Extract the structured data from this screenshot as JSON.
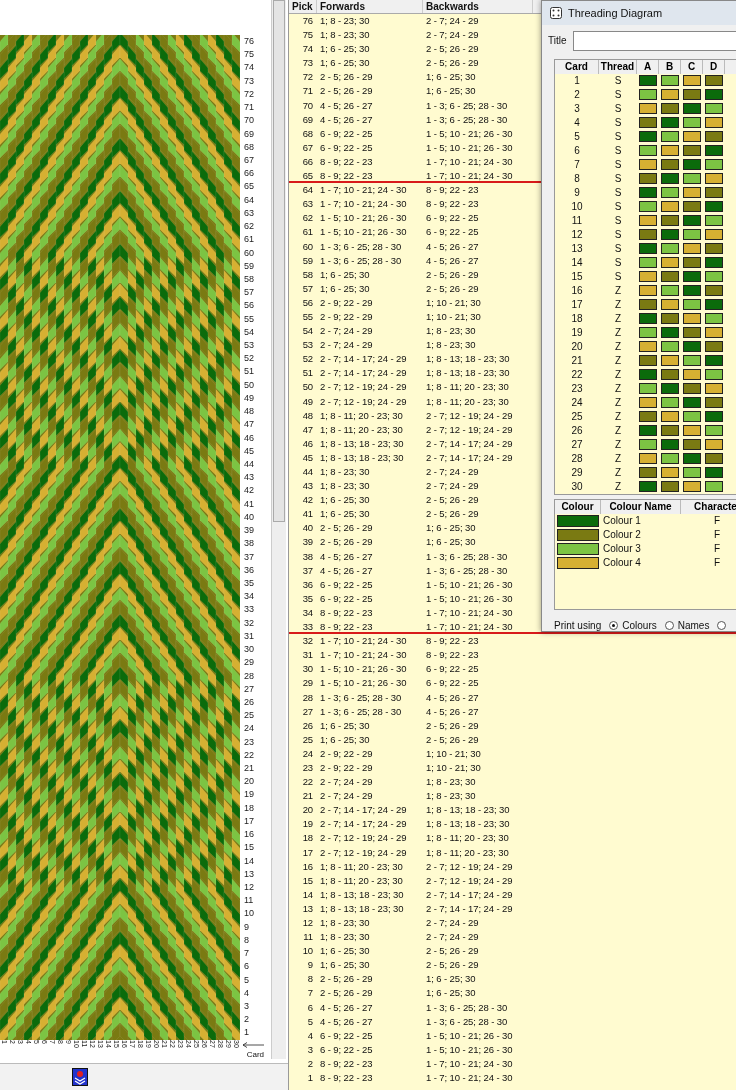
{
  "band": {
    "pick_labels": [
      "76",
      "75",
      "74",
      "73",
      "72",
      "71",
      "70",
      "69",
      "68",
      "67",
      "66",
      "65",
      "64",
      "63",
      "62",
      "61",
      "60",
      "59",
      "58",
      "57",
      "56",
      "55",
      "54",
      "53",
      "52",
      "51",
      "50",
      "49",
      "48",
      "47",
      "46",
      "45",
      "44",
      "43",
      "42",
      "41",
      "40",
      "39",
      "38",
      "37",
      "36",
      "35",
      "34",
      "33",
      "32",
      "31",
      "30",
      "29",
      "28",
      "27",
      "26",
      "25",
      "24",
      "23",
      "22",
      "21",
      "20",
      "19",
      "18",
      "17",
      "16",
      "15",
      "14",
      "13",
      "12",
      "11",
      "10",
      "9",
      "8",
      "7",
      "6",
      "5",
      "4",
      "3",
      "2",
      "1"
    ],
    "card_labels": [
      "1",
      "2",
      "3",
      "4",
      "5",
      "6",
      "7",
      "8",
      "9",
      "10",
      "11",
      "12",
      "13",
      "14",
      "15",
      "16",
      "17",
      "18",
      "19",
      "20",
      "21",
      "22",
      "23",
      "24",
      "25",
      "26",
      "27",
      "28",
      "29",
      "30"
    ],
    "axis_label": "Card"
  },
  "turning_table": {
    "columns": [
      "Pick",
      "Forwards",
      "Backwards"
    ],
    "rows": [
      {
        "pick": "76",
        "forwards": "1; 8 - 23; 30",
        "backwards": "2 - 7; 24 - 29",
        "marked": false
      },
      {
        "pick": "75",
        "forwards": "1; 8 - 23; 30",
        "backwards": "2 - 7; 24 - 29",
        "marked": false
      },
      {
        "pick": "74",
        "forwards": "1; 6 - 25; 30",
        "backwards": "2 - 5; 26 - 29",
        "marked": false
      },
      {
        "pick": "73",
        "forwards": "1; 6 - 25; 30",
        "backwards": "2 - 5; 26 - 29",
        "marked": false
      },
      {
        "pick": "72",
        "forwards": "2 - 5; 26 - 29",
        "backwards": "1; 6 - 25; 30",
        "marked": false
      },
      {
        "pick": "71",
        "forwards": "2 - 5; 26 - 29",
        "backwards": "1; 6 - 25; 30",
        "marked": false
      },
      {
        "pick": "70",
        "forwards": "4 - 5; 26 - 27",
        "backwards": "1 - 3; 6 - 25; 28 - 30",
        "marked": false
      },
      {
        "pick": "69",
        "forwards": "4 - 5; 26 - 27",
        "backwards": "1 - 3; 6 - 25; 28 - 30",
        "marked": false
      },
      {
        "pick": "68",
        "forwards": "6 - 9; 22 - 25",
        "backwards": "1 - 5; 10 - 21; 26 - 30",
        "marked": false
      },
      {
        "pick": "67",
        "forwards": "6 - 9; 22 - 25",
        "backwards": "1 - 5; 10 - 21; 26 - 30",
        "marked": false
      },
      {
        "pick": "66",
        "forwards": "8 - 9; 22 - 23",
        "backwards": "1 - 7; 10 - 21; 24 - 30",
        "marked": false
      },
      {
        "pick": "65",
        "forwards": "8 - 9; 22 - 23",
        "backwards": "1 - 7; 10 - 21; 24 - 30",
        "marked": true
      },
      {
        "pick": "64",
        "forwards": "1 - 7; 10 - 21; 24 - 30",
        "backwards": "8 - 9; 22 - 23",
        "marked": false
      },
      {
        "pick": "63",
        "forwards": "1 - 7; 10 - 21; 24 - 30",
        "backwards": "8 - 9; 22 - 23",
        "marked": false
      },
      {
        "pick": "62",
        "forwards": "1 - 5; 10 - 21; 26 - 30",
        "backwards": "6 - 9; 22 - 25",
        "marked": false
      },
      {
        "pick": "61",
        "forwards": "1 - 5; 10 - 21; 26 - 30",
        "backwards": "6 - 9; 22 - 25",
        "marked": false
      },
      {
        "pick": "60",
        "forwards": "1 - 3; 6 - 25; 28 - 30",
        "backwards": "4 - 5; 26 - 27",
        "marked": false
      },
      {
        "pick": "59",
        "forwards": "1 - 3; 6 - 25; 28 - 30",
        "backwards": "4 - 5; 26 - 27",
        "marked": false
      },
      {
        "pick": "58",
        "forwards": "1; 6 - 25; 30",
        "backwards": "2 - 5; 26 - 29",
        "marked": false
      },
      {
        "pick": "57",
        "forwards": "1; 6 - 25; 30",
        "backwards": "2 - 5; 26 - 29",
        "marked": false
      },
      {
        "pick": "56",
        "forwards": "2 - 9; 22 - 29",
        "backwards": "1; 10 - 21; 30",
        "marked": false
      },
      {
        "pick": "55",
        "forwards": "2 - 9; 22 - 29",
        "backwards": "1; 10 - 21; 30",
        "marked": false
      },
      {
        "pick": "54",
        "forwards": "2 - 7; 24 - 29",
        "backwards": "1; 8 - 23; 30",
        "marked": false
      },
      {
        "pick": "53",
        "forwards": "2 - 7; 24 - 29",
        "backwards": "1; 8 - 23; 30",
        "marked": false
      },
      {
        "pick": "52",
        "forwards": "2 - 7; 14 - 17; 24 - 29",
        "backwards": "1; 8 - 13; 18 - 23; 30",
        "marked": false
      },
      {
        "pick": "51",
        "forwards": "2 - 7; 14 - 17; 24 - 29",
        "backwards": "1; 8 - 13; 18 - 23; 30",
        "marked": false
      },
      {
        "pick": "50",
        "forwards": "2 - 7; 12 - 19; 24 - 29",
        "backwards": "1; 8 - 11; 20 - 23; 30",
        "marked": false
      },
      {
        "pick": "49",
        "forwards": "2 - 7; 12 - 19; 24 - 29",
        "backwards": "1; 8 - 11; 20 - 23; 30",
        "marked": false
      },
      {
        "pick": "48",
        "forwards": "1; 8 - 11; 20 - 23; 30",
        "backwards": "2 - 7; 12 - 19; 24 - 29",
        "marked": false
      },
      {
        "pick": "47",
        "forwards": "1; 8 - 11; 20 - 23; 30",
        "backwards": "2 - 7; 12 - 19; 24 - 29",
        "marked": false
      },
      {
        "pick": "46",
        "forwards": "1; 8 - 13; 18 - 23; 30",
        "backwards": "2 - 7; 14 - 17; 24 - 29",
        "marked": false
      },
      {
        "pick": "45",
        "forwards": "1; 8 - 13; 18 - 23; 30",
        "backwards": "2 - 7; 14 - 17; 24 - 29",
        "marked": false
      },
      {
        "pick": "44",
        "forwards": "1; 8 - 23; 30",
        "backwards": "2 - 7; 24 - 29",
        "marked": false
      },
      {
        "pick": "43",
        "forwards": "1; 8 - 23; 30",
        "backwards": "2 - 7; 24 - 29",
        "marked": false
      },
      {
        "pick": "42",
        "forwards": "1; 6 - 25; 30",
        "backwards": "2 - 5; 26 - 29",
        "marked": false
      },
      {
        "pick": "41",
        "forwards": "1; 6 - 25; 30",
        "backwards": "2 - 5; 26 - 29",
        "marked": false
      },
      {
        "pick": "40",
        "forwards": "2 - 5; 26 - 29",
        "backwards": "1; 6 - 25; 30",
        "marked": false
      },
      {
        "pick": "39",
        "forwards": "2 - 5; 26 - 29",
        "backwards": "1; 6 - 25; 30",
        "marked": false
      },
      {
        "pick": "38",
        "forwards": "4 - 5; 26 - 27",
        "backwards": "1 - 3; 6 - 25; 28 - 30",
        "marked": false
      },
      {
        "pick": "37",
        "forwards": "4 - 5; 26 - 27",
        "backwards": "1 - 3; 6 - 25; 28 - 30",
        "marked": false
      },
      {
        "pick": "36",
        "forwards": "6 - 9; 22 - 25",
        "backwards": "1 - 5; 10 - 21; 26 - 30",
        "marked": false
      },
      {
        "pick": "35",
        "forwards": "6 - 9; 22 - 25",
        "backwards": "1 - 5; 10 - 21; 26 - 30",
        "marked": false
      },
      {
        "pick": "34",
        "forwards": "8 - 9; 22 - 23",
        "backwards": "1 - 7; 10 - 21; 24 - 30",
        "marked": false
      },
      {
        "pick": "33",
        "forwards": "8 - 9; 22 - 23",
        "backwards": "1 - 7; 10 - 21; 24 - 30",
        "marked": true
      },
      {
        "pick": "32",
        "forwards": "1 - 7; 10 - 21; 24 - 30",
        "backwards": "8 - 9; 22 - 23",
        "marked": false
      },
      {
        "pick": "31",
        "forwards": "1 - 7; 10 - 21; 24 - 30",
        "backwards": "8 - 9; 22 - 23",
        "marked": false
      },
      {
        "pick": "30",
        "forwards": "1 - 5; 10 - 21; 26 - 30",
        "backwards": "6 - 9; 22 - 25",
        "marked": false
      },
      {
        "pick": "29",
        "forwards": "1 - 5; 10 - 21; 26 - 30",
        "backwards": "6 - 9; 22 - 25",
        "marked": false
      },
      {
        "pick": "28",
        "forwards": "1 - 3; 6 - 25; 28 - 30",
        "backwards": "4 - 5; 26 - 27",
        "marked": false
      },
      {
        "pick": "27",
        "forwards": "1 - 3; 6 - 25; 28 - 30",
        "backwards": "4 - 5; 26 - 27",
        "marked": false
      },
      {
        "pick": "26",
        "forwards": "1; 6 - 25; 30",
        "backwards": "2 - 5; 26 - 29",
        "marked": false
      },
      {
        "pick": "25",
        "forwards": "1; 6 - 25; 30",
        "backwards": "2 - 5; 26 - 29",
        "marked": false
      },
      {
        "pick": "24",
        "forwards": "2 - 9; 22 - 29",
        "backwards": "1; 10 - 21; 30",
        "marked": false
      },
      {
        "pick": "23",
        "forwards": "2 - 9; 22 - 29",
        "backwards": "1; 10 - 21; 30",
        "marked": false
      },
      {
        "pick": "22",
        "forwards": "2 - 7; 24 - 29",
        "backwards": "1; 8 - 23; 30",
        "marked": false
      },
      {
        "pick": "21",
        "forwards": "2 - 7; 24 - 29",
        "backwards": "1; 8 - 23; 30",
        "marked": false
      },
      {
        "pick": "20",
        "forwards": "2 - 7; 14 - 17; 24 - 29",
        "backwards": "1; 8 - 13; 18 - 23; 30",
        "marked": false
      },
      {
        "pick": "19",
        "forwards": "2 - 7; 14 - 17; 24 - 29",
        "backwards": "1; 8 - 13; 18 - 23; 30",
        "marked": false
      },
      {
        "pick": "18",
        "forwards": "2 - 7; 12 - 19; 24 - 29",
        "backwards": "1; 8 - 11; 20 - 23; 30",
        "marked": false
      },
      {
        "pick": "17",
        "forwards": "2 - 7; 12 - 19; 24 - 29",
        "backwards": "1; 8 - 11; 20 - 23; 30",
        "marked": false
      },
      {
        "pick": "16",
        "forwards": "1; 8 - 11; 20 - 23; 30",
        "backwards": "2 - 7; 12 - 19; 24 - 29",
        "marked": false
      },
      {
        "pick": "15",
        "forwards": "1; 8 - 11; 20 - 23; 30",
        "backwards": "2 - 7; 12 - 19; 24 - 29",
        "marked": false
      },
      {
        "pick": "14",
        "forwards": "1; 8 - 13; 18 - 23; 30",
        "backwards": "2 - 7; 14 - 17; 24 - 29",
        "marked": false
      },
      {
        "pick": "13",
        "forwards": "1; 8 - 13; 18 - 23; 30",
        "backwards": "2 - 7; 14 - 17; 24 - 29",
        "marked": false
      },
      {
        "pick": "12",
        "forwards": "1; 8 - 23; 30",
        "backwards": "2 - 7; 24 - 29",
        "marked": false
      },
      {
        "pick": "11",
        "forwards": "1; 8 - 23; 30",
        "backwards": "2 - 7; 24 - 29",
        "marked": false
      },
      {
        "pick": "10",
        "forwards": "1; 6 - 25; 30",
        "backwards": "2 - 5; 26 - 29",
        "marked": false
      },
      {
        "pick": "9",
        "forwards": "1; 6 - 25; 30",
        "backwards": "2 - 5; 26 - 29",
        "marked": false
      },
      {
        "pick": "8",
        "forwards": "2 - 5; 26 - 29",
        "backwards": "1; 6 - 25; 30",
        "marked": false
      },
      {
        "pick": "7",
        "forwards": "2 - 5; 26 - 29",
        "backwards": "1; 6 - 25; 30",
        "marked": false
      },
      {
        "pick": "6",
        "forwards": "4 - 5; 26 - 27",
        "backwards": "1 - 3; 6 - 25; 28 - 30",
        "marked": false
      },
      {
        "pick": "5",
        "forwards": "4 - 5; 26 - 27",
        "backwards": "1 - 3; 6 - 25; 28 - 30",
        "marked": false
      },
      {
        "pick": "4",
        "forwards": "6 - 9; 22 - 25",
        "backwards": "1 - 5; 10 - 21; 26 - 30",
        "marked": false
      },
      {
        "pick": "3",
        "forwards": "6 - 9; 22 - 25",
        "backwards": "1 - 5; 10 - 21; 26 - 30",
        "marked": false
      },
      {
        "pick": "2",
        "forwards": "8 - 9; 22 - 23",
        "backwards": "1 - 7; 10 - 21; 24 - 30",
        "marked": false
      },
      {
        "pick": "1",
        "forwards": "8 - 9; 22 - 23",
        "backwards": "1 - 7; 10 - 21; 24 - 30",
        "marked": false
      }
    ]
  },
  "threading_dialog": {
    "title": "Threading Diagram",
    "title_field_label": "Title",
    "card_columns": [
      "Card",
      "Thread",
      "A",
      "B",
      "C",
      "D"
    ],
    "cards": [
      {
        "card": "1",
        "thread": "S",
        "holes": [
          {
            "color": "#0b6b0b"
          },
          {
            "color": "#7cc443"
          },
          {
            "color": "#d6b032"
          },
          {
            "color": "#7a7a12"
          }
        ]
      },
      {
        "card": "2",
        "thread": "S",
        "holes": [
          {
            "color": "#7cc443"
          },
          {
            "color": "#d6b032"
          },
          {
            "color": "#7a7a12"
          },
          {
            "color": "#0b6b0b"
          }
        ]
      },
      {
        "card": "3",
        "thread": "S",
        "holes": [
          {
            "color": "#d6b032"
          },
          {
            "color": "#7a7a12"
          },
          {
            "color": "#0b6b0b"
          },
          {
            "color": "#7cc443"
          }
        ]
      },
      {
        "card": "4",
        "thread": "S",
        "holes": [
          {
            "color": "#7a7a12"
          },
          {
            "color": "#0b6b0b"
          },
          {
            "color": "#7cc443"
          },
          {
            "color": "#d6b032"
          }
        ]
      },
      {
        "card": "5",
        "thread": "S",
        "holes": [
          {
            "color": "#0b6b0b"
          },
          {
            "color": "#7cc443"
          },
          {
            "color": "#d6b032"
          },
          {
            "color": "#7a7a12"
          }
        ]
      },
      {
        "card": "6",
        "thread": "S",
        "holes": [
          {
            "color": "#7cc443"
          },
          {
            "color": "#d6b032"
          },
          {
            "color": "#7a7a12"
          },
          {
            "color": "#0b6b0b"
          }
        ]
      },
      {
        "card": "7",
        "thread": "S",
        "holes": [
          {
            "color": "#d6b032"
          },
          {
            "color": "#7a7a12"
          },
          {
            "color": "#0b6b0b"
          },
          {
            "color": "#7cc443"
          }
        ]
      },
      {
        "card": "8",
        "thread": "S",
        "holes": [
          {
            "color": "#7a7a12"
          },
          {
            "color": "#0b6b0b"
          },
          {
            "color": "#7cc443"
          },
          {
            "color": "#d6b032"
          }
        ]
      },
      {
        "card": "9",
        "thread": "S",
        "holes": [
          {
            "color": "#0b6b0b"
          },
          {
            "color": "#7cc443"
          },
          {
            "color": "#d6b032"
          },
          {
            "color": "#7a7a12"
          }
        ]
      },
      {
        "card": "10",
        "thread": "S",
        "holes": [
          {
            "color": "#7cc443"
          },
          {
            "color": "#d6b032"
          },
          {
            "color": "#7a7a12"
          },
          {
            "color": "#0b6b0b"
          }
        ]
      },
      {
        "card": "11",
        "thread": "S",
        "holes": [
          {
            "color": "#d6b032"
          },
          {
            "color": "#7a7a12"
          },
          {
            "color": "#0b6b0b"
          },
          {
            "color": "#7cc443"
          }
        ]
      },
      {
        "card": "12",
        "thread": "S",
        "holes": [
          {
            "color": "#7a7a12"
          },
          {
            "color": "#0b6b0b"
          },
          {
            "color": "#7cc443"
          },
          {
            "color": "#d6b032"
          }
        ]
      },
      {
        "card": "13",
        "thread": "S",
        "holes": [
          {
            "color": "#0b6b0b"
          },
          {
            "color": "#7cc443"
          },
          {
            "color": "#d6b032"
          },
          {
            "color": "#7a7a12"
          }
        ]
      },
      {
        "card": "14",
        "thread": "S",
        "holes": [
          {
            "color": "#7cc443"
          },
          {
            "color": "#d6b032"
          },
          {
            "color": "#7a7a12"
          },
          {
            "color": "#0b6b0b"
          }
        ]
      },
      {
        "card": "15",
        "thread": "S",
        "holes": [
          {
            "color": "#d6b032"
          },
          {
            "color": "#7a7a12"
          },
          {
            "color": "#0b6b0b"
          },
          {
            "color": "#7cc443"
          }
        ]
      },
      {
        "card": "16",
        "thread": "Z",
        "holes": [
          {
            "color": "#d6b032"
          },
          {
            "color": "#7cc443"
          },
          {
            "color": "#0b6b0b"
          },
          {
            "color": "#7a7a12"
          }
        ]
      },
      {
        "card": "17",
        "thread": "Z",
        "holes": [
          {
            "color": "#7a7a12"
          },
          {
            "color": "#d6b032"
          },
          {
            "color": "#7cc443"
          },
          {
            "color": "#0b6b0b"
          }
        ]
      },
      {
        "card": "18",
        "thread": "Z",
        "holes": [
          {
            "color": "#0b6b0b"
          },
          {
            "color": "#7a7a12"
          },
          {
            "color": "#d6b032"
          },
          {
            "color": "#7cc443"
          }
        ]
      },
      {
        "card": "19",
        "thread": "Z",
        "holes": [
          {
            "color": "#7cc443"
          },
          {
            "color": "#0b6b0b"
          },
          {
            "color": "#7a7a12"
          },
          {
            "color": "#d6b032"
          }
        ]
      },
      {
        "card": "20",
        "thread": "Z",
        "holes": [
          {
            "color": "#d6b032"
          },
          {
            "color": "#7cc443"
          },
          {
            "color": "#0b6b0b"
          },
          {
            "color": "#7a7a12"
          }
        ]
      },
      {
        "card": "21",
        "thread": "Z",
        "holes": [
          {
            "color": "#7a7a12"
          },
          {
            "color": "#d6b032"
          },
          {
            "color": "#7cc443"
          },
          {
            "color": "#0b6b0b"
          }
        ]
      },
      {
        "card": "22",
        "thread": "Z",
        "holes": [
          {
            "color": "#0b6b0b"
          },
          {
            "color": "#7a7a12"
          },
          {
            "color": "#d6b032"
          },
          {
            "color": "#7cc443"
          }
        ]
      },
      {
        "card": "23",
        "thread": "Z",
        "holes": [
          {
            "color": "#7cc443"
          },
          {
            "color": "#0b6b0b"
          },
          {
            "color": "#7a7a12"
          },
          {
            "color": "#d6b032"
          }
        ]
      },
      {
        "card": "24",
        "thread": "Z",
        "holes": [
          {
            "color": "#d6b032"
          },
          {
            "color": "#7cc443"
          },
          {
            "color": "#0b6b0b"
          },
          {
            "color": "#7a7a12"
          }
        ]
      },
      {
        "card": "25",
        "thread": "Z",
        "holes": [
          {
            "color": "#7a7a12"
          },
          {
            "color": "#d6b032"
          },
          {
            "color": "#7cc443"
          },
          {
            "color": "#0b6b0b"
          }
        ]
      },
      {
        "card": "26",
        "thread": "Z",
        "holes": [
          {
            "color": "#0b6b0b"
          },
          {
            "color": "#7a7a12"
          },
          {
            "color": "#d6b032"
          },
          {
            "color": "#7cc443"
          }
        ]
      },
      {
        "card": "27",
        "thread": "Z",
        "holes": [
          {
            "color": "#7cc443"
          },
          {
            "color": "#0b6b0b"
          },
          {
            "color": "#7a7a12"
          },
          {
            "color": "#d6b032"
          }
        ]
      },
      {
        "card": "28",
        "thread": "Z",
        "holes": [
          {
            "color": "#d6b032"
          },
          {
            "color": "#7cc443"
          },
          {
            "color": "#0b6b0b"
          },
          {
            "color": "#7a7a12"
          }
        ]
      },
      {
        "card": "29",
        "thread": "Z",
        "holes": [
          {
            "color": "#7a7a12"
          },
          {
            "color": "#d6b032"
          },
          {
            "color": "#7cc443"
          },
          {
            "color": "#0b6b0b"
          }
        ]
      },
      {
        "card": "30",
        "thread": "Z",
        "holes": [
          {
            "color": "#0b6b0b"
          },
          {
            "color": "#7a7a12"
          },
          {
            "color": "#d6b032"
          },
          {
            "color": "#7cc443"
          }
        ]
      }
    ],
    "colour_columns": [
      "Colour",
      "Colour Name",
      "Characte"
    ],
    "colours": [
      {
        "color": "#0b6b0b",
        "name": "Colour 1",
        "character": "F"
      },
      {
        "color": "#7a7a12",
        "name": "Colour 2",
        "character": "F"
      },
      {
        "color": "#7cc443",
        "name": "Colour 3",
        "character": "F"
      },
      {
        "color": "#d6b032",
        "name": "Colour 4",
        "character": "F"
      }
    ],
    "print_using": {
      "label": "Print using",
      "options": [
        {
          "label": "Colours",
          "selected": true
        },
        {
          "label": "Names",
          "selected": false
        },
        {
          "selected": false
        }
      ]
    }
  }
}
